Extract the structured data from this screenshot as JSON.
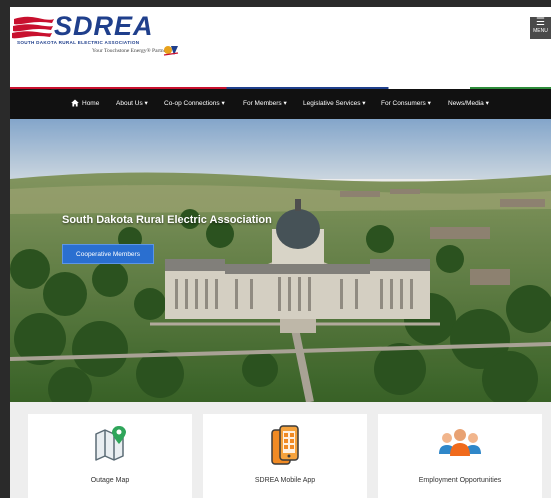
{
  "header": {
    "logo_text": "SDREA",
    "logo_subtitle": "SOUTH DAKOTA RURAL ELECTRIC ASSOCIATION",
    "logo_tagline": "Your Touchstone Energy® Partner",
    "menu_label": "MENU"
  },
  "nav": {
    "items": [
      {
        "label": "Home"
      },
      {
        "label": "About Us ▾"
      },
      {
        "label": "Co-op Connections ▾"
      },
      {
        "label": "For Members ▾"
      },
      {
        "label": "Legislative Services ▾"
      },
      {
        "label": "For Consumers ▾"
      },
      {
        "label": "News/Media ▾"
      }
    ]
  },
  "hero": {
    "title": "South Dakota Rural Electric Association",
    "button_label": "Cooperative Members"
  },
  "cards": [
    {
      "label": "Outage Map",
      "icon": "map-pin-icon"
    },
    {
      "label": "SDREA Mobile App",
      "icon": "mobile-app-icon"
    },
    {
      "label": "Employment Opportunities",
      "icon": "people-group-icon"
    }
  ],
  "colors": {
    "brand_blue": "#1f3f8c",
    "brand_red": "#c8102e",
    "nav_background": "#111111",
    "button_blue": "#2a6fd0"
  }
}
